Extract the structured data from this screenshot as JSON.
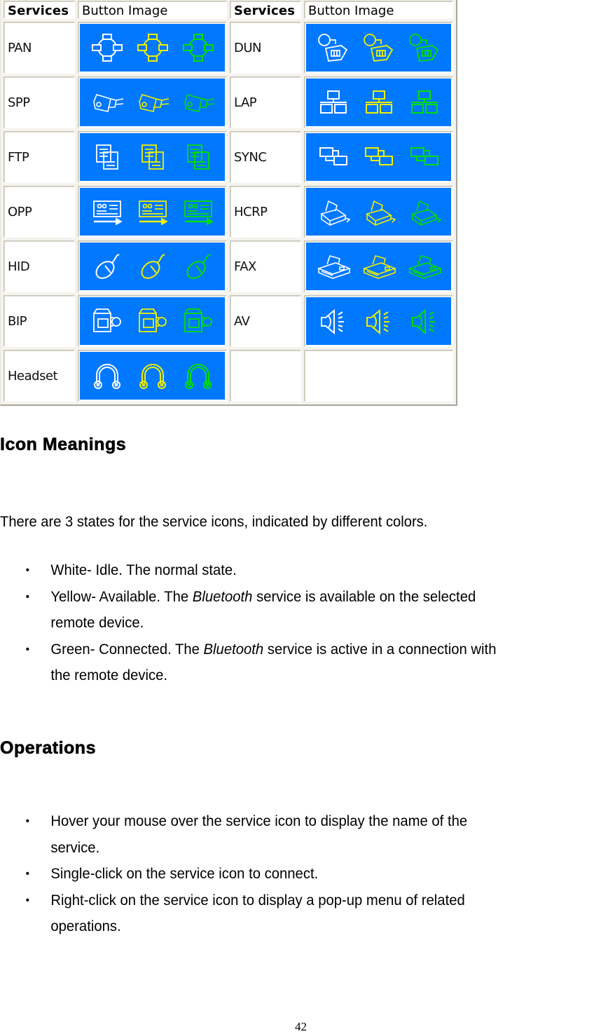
{
  "table": {
    "headers": [
      "Services",
      "Button Image",
      "Services",
      "Button Image"
    ],
    "rows": [
      {
        "left": {
          "name": "PAN",
          "icon": "network-icon"
        },
        "right": {
          "name": "DUN",
          "icon": "dial-up-phone-icon"
        }
      },
      {
        "left": {
          "name": "SPP",
          "icon": "serial-plug-icon"
        },
        "right": {
          "name": "LAP",
          "icon": "lan-access-icon"
        }
      },
      {
        "left": {
          "name": "FTP",
          "icon": "file-documents-icon"
        },
        "right": {
          "name": "SYNC",
          "icon": "sync-windows-icon"
        }
      },
      {
        "left": {
          "name": "OPP",
          "icon": "business-card-icon"
        },
        "right": {
          "name": "HCRP",
          "icon": "printer-icon"
        }
      },
      {
        "left": {
          "name": "HID",
          "icon": "mouse-icon"
        },
        "right": {
          "name": "FAX",
          "icon": "fax-machine-icon"
        }
      },
      {
        "left": {
          "name": "BIP",
          "icon": "camera-icon"
        },
        "right": {
          "name": "AV",
          "icon": "speaker-icon"
        }
      },
      {
        "left": {
          "name": "Headset",
          "icon": "headset-icon"
        },
        "right": {
          "name": "",
          "icon": ""
        }
      }
    ],
    "state_colors": {
      "idle": "#ffffff",
      "available": "#f0f000",
      "connected": "#00e000"
    },
    "button_bg": "#0078ff"
  },
  "icon_meanings": {
    "heading": "Icon Meanings",
    "intro": "There are 3 states for the service icons, indicated by different colors.",
    "states": [
      {
        "pre": "White- Idle. The normal state.",
        "em": "",
        "post": ""
      },
      {
        "pre": "Yellow- Available. The ",
        "em": "Bluetooth",
        "post": " service is available on the selected",
        "cont": "remote device."
      },
      {
        "pre": "Green- Connected. The ",
        "em": "Bluetooth",
        "post": " service is active in a connection with",
        "cont": "the remote device."
      }
    ]
  },
  "operations": {
    "heading": "Operations",
    "items": [
      {
        "line1": "Hover your mouse over the service icon to display the name of the",
        "line2": "service."
      },
      {
        "line1": "Single-click on the service icon to connect.",
        "line2": ""
      },
      {
        "line1": "Right-click on the service icon to display a pop-up menu of related",
        "line2": "operations."
      }
    ]
  },
  "bullet_char": "•",
  "page_number": "42"
}
